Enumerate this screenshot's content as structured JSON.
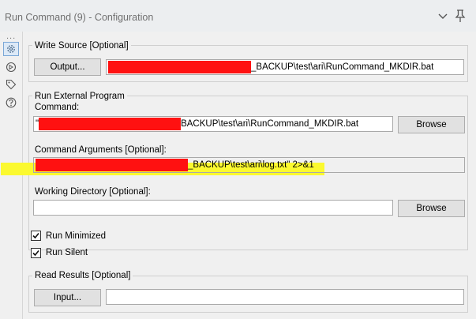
{
  "window": {
    "title": "Run Command (9) - Configuration"
  },
  "sidebar": {
    "more": "...",
    "icons": [
      "gear-icon",
      "configuration-icon",
      "tag-icon",
      "help-icon"
    ]
  },
  "write_source": {
    "label": "Write Source [Optional]",
    "output_button": "Output...",
    "value_suffix": "_BACKUP\\test\\ari\\RunCommand_MKDIR.bat"
  },
  "run_external": {
    "label": "Run External Program",
    "command_label": "Command:",
    "command_prefix": "\"",
    "command_value_suffix": "BACKUP\\test\\ari\\RunCommand_MKDIR.bat",
    "browse_label": "Browse",
    "args_label": "Command Arguments [Optional]:",
    "args_value_suffix": "_BACKUP\\test\\ari\\log.txt\" 2>&1",
    "workdir_label": "Working Directory [Optional]:",
    "workdir_value": "",
    "browse2_label": "Browse"
  },
  "options": {
    "run_minimized": {
      "label": "Run Minimized",
      "checked": true
    },
    "run_silent": {
      "label": "Run Silent",
      "checked": true
    }
  },
  "read_results": {
    "label": "Read Results [Optional]",
    "input_button": "Input...",
    "value": ""
  },
  "colors": {
    "redaction": "#ff1111",
    "highlight": "#fbf92f",
    "border": "#cfcfcf"
  }
}
